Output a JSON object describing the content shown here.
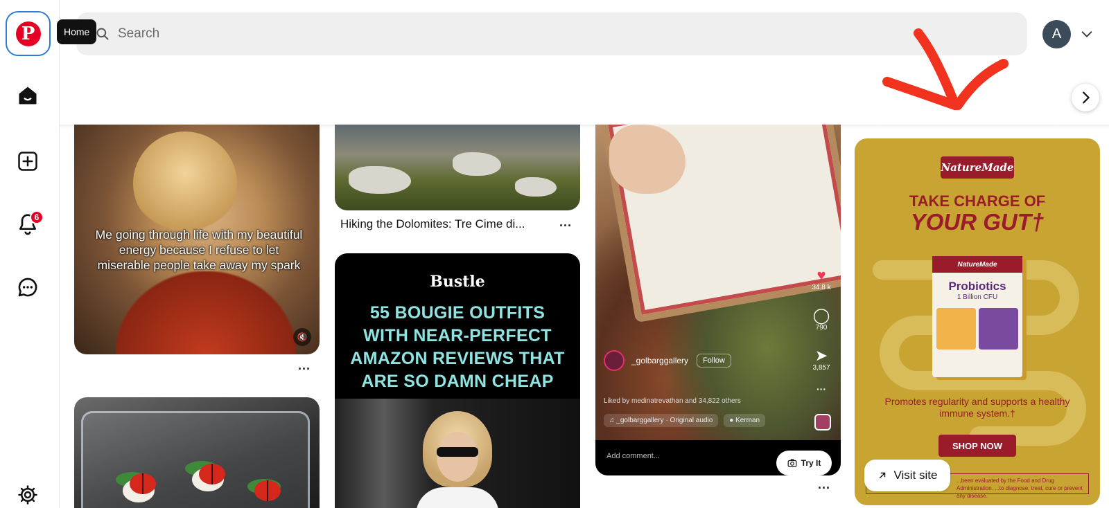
{
  "sidebar": {
    "tooltip": "Home",
    "notifications_badge": "6",
    "items": [
      {
        "name": "home",
        "icon": "home-icon"
      },
      {
        "name": "create",
        "icon": "plus-square-icon"
      },
      {
        "name": "notifications",
        "icon": "bell-icon"
      },
      {
        "name": "messages",
        "icon": "chat-icon"
      },
      {
        "name": "settings",
        "icon": "gear-icon"
      }
    ]
  },
  "header": {
    "search_placeholder": "Search",
    "avatar_initial": "A"
  },
  "pins": {
    "pin1": {
      "caption": "Me going through life with my beautiful energy because I refuse to let miserable people take away my spark",
      "more": "..."
    },
    "pin3": {
      "title": "Hiking the Dolomites: Tre Cime di...",
      "more": "..."
    },
    "pin4": {
      "brand": "Bustle",
      "headline": "55 BOUGIE OUTFITS WITH NEAR-PERFECT AMAZON REVIEWS THAT ARE SO DAMN CHEAP"
    },
    "pin5": {
      "likes": "34.8 k",
      "comments": "790",
      "shares": "3,857",
      "username": "_golbarggallery",
      "follow": "Follow",
      "liked_by": "Liked by medinatrevathan and 34,822 others",
      "audio": "_golbarggallery · Original audio",
      "location": "Kerman",
      "comment_placeholder": "Add comment...",
      "try_it": "Try It",
      "more": "..."
    },
    "pin6": {
      "logo": "NatureMade",
      "headline_1": "TAKE CHARGE OF",
      "headline_2": "YOUR GUT†",
      "box_brand": "NatureMade",
      "box_title": "Probiotics",
      "box_sub": "1 Billion CFU",
      "promo": "Promotes regularity and supports a healthy immune system.†",
      "shop": "SHOP NOW",
      "fine_print": "...been evaluated by the Food and Drug Administration. ...to diagnose, treat, cure or prevent any disease.",
      "visit": "Visit site"
    }
  },
  "colors": {
    "brand": "#e60023",
    "annotation_arrow": "#f0321e"
  }
}
